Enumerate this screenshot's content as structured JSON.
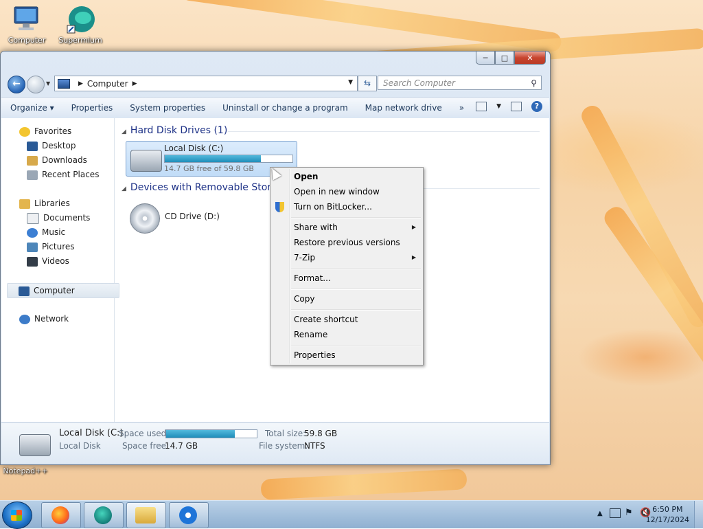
{
  "desktop": {
    "icons": [
      {
        "label": "Computer",
        "icon": "computer-icon"
      },
      {
        "label": "Supermium",
        "icon": "supermium-icon"
      },
      {
        "label": "Notepad++",
        "icon": "notepadpp-icon"
      }
    ]
  },
  "window": {
    "address": {
      "segments": [
        "Computer"
      ]
    },
    "search": {
      "placeholder": "Search Computer"
    },
    "toolbar": {
      "organize": "Organize",
      "properties": "Properties",
      "system_properties": "System properties",
      "uninstall": "Uninstall or change a program",
      "map_drive": "Map network drive",
      "more": "»"
    },
    "nav": {
      "favorites": "Favorites",
      "desktop": "Desktop",
      "downloads": "Downloads",
      "recent": "Recent Places",
      "libraries": "Libraries",
      "documents": "Documents",
      "music": "Music",
      "pictures": "Pictures",
      "videos": "Videos",
      "computer": "Computer",
      "network": "Network"
    },
    "groups": {
      "hdd": "Hard Disk Drives (1)",
      "removable": "Devices with Removable Storage (1)"
    },
    "drives": {
      "c": {
        "name": "Local Disk (C:)",
        "free_text": "14.7 GB free of 59.8 GB",
        "used_fraction": 0.754
      },
      "d": {
        "name": "CD Drive (D:)"
      }
    },
    "details": {
      "name": "Local Disk (C:)",
      "type": "Local Disk",
      "space_used_label": "Space used:",
      "space_free_label": "Space free:",
      "space_free": "14.7 GB",
      "total_size_label": "Total size:",
      "total_size": "59.8 GB",
      "fs_label": "File system:",
      "fs": "NTFS",
      "used_fraction": 0.754
    }
  },
  "context_menu": {
    "items": [
      "Open",
      "Open in new window",
      "Turn on BitLocker...",
      "Share with",
      "Restore previous versions",
      "7-Zip",
      "Format...",
      "Copy",
      "Create shortcut",
      "Rename",
      "Properties"
    ]
  },
  "taskbar": {
    "buttons": [
      "start-button",
      "firefox",
      "supermium",
      "explorer",
      "teamviewer"
    ],
    "clock": {
      "time": "6:50 PM",
      "date": "12/17/2024"
    }
  }
}
